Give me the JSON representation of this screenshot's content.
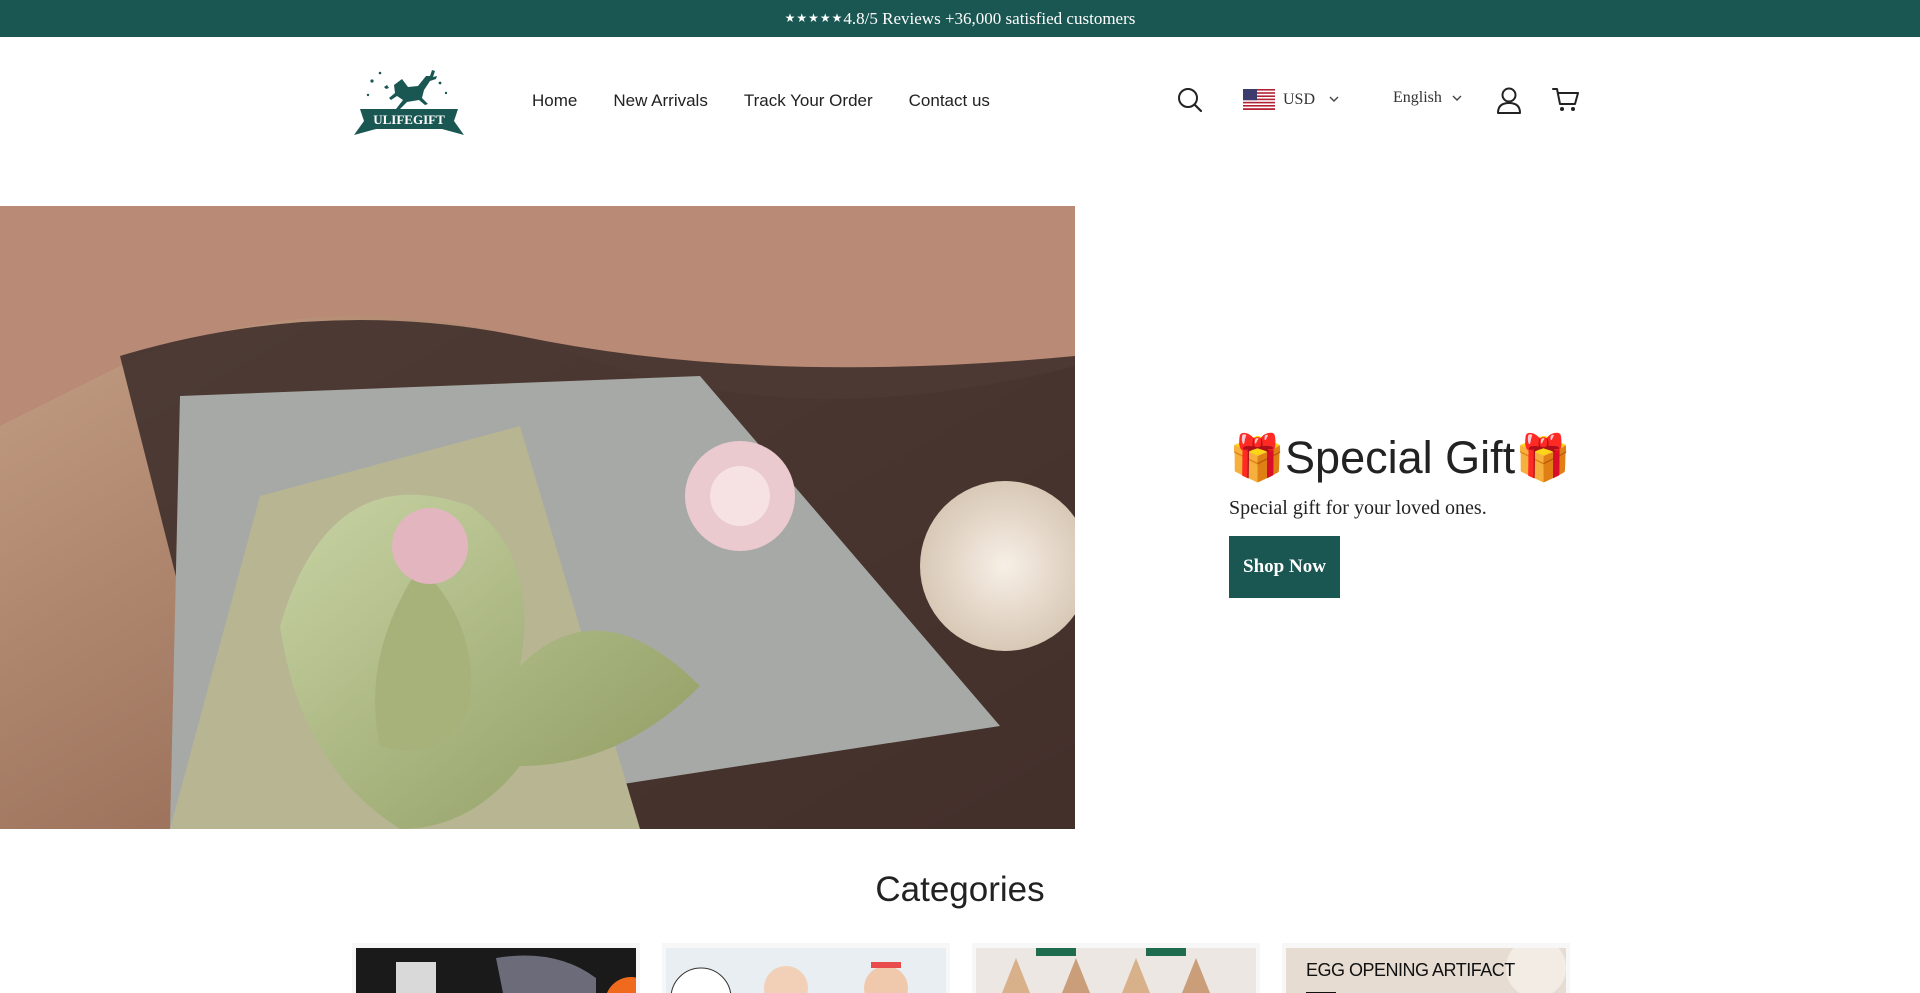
{
  "announcement": {
    "stars": "★★★★★",
    "text": "4.8/5 Reviews +36,000 satisfied customers"
  },
  "header": {
    "logo_text": "ULIFEGIFT",
    "nav": [
      {
        "label": "Home"
      },
      {
        "label": "New Arrivals"
      },
      {
        "label": "Track Your Order"
      },
      {
        "label": "Contact us"
      }
    ],
    "currency": "USD",
    "language": "English",
    "icons": [
      "search-icon",
      "us-flag-icon",
      "user-icon",
      "cart-icon"
    ]
  },
  "hero": {
    "title": "🎁Special Gift🎁",
    "subtitle": "Special gift for your loved ones.",
    "button": "Shop Now"
  },
  "categories": {
    "title": "Categories",
    "cards": [
      {
        "label": ""
      },
      {
        "label": ""
      },
      {
        "label": ""
      },
      {
        "label": "EGG OPENING ARTIFACT"
      }
    ]
  },
  "colors": {
    "brand": "#1a5753",
    "text": "#222222",
    "background": "#ffffff"
  }
}
